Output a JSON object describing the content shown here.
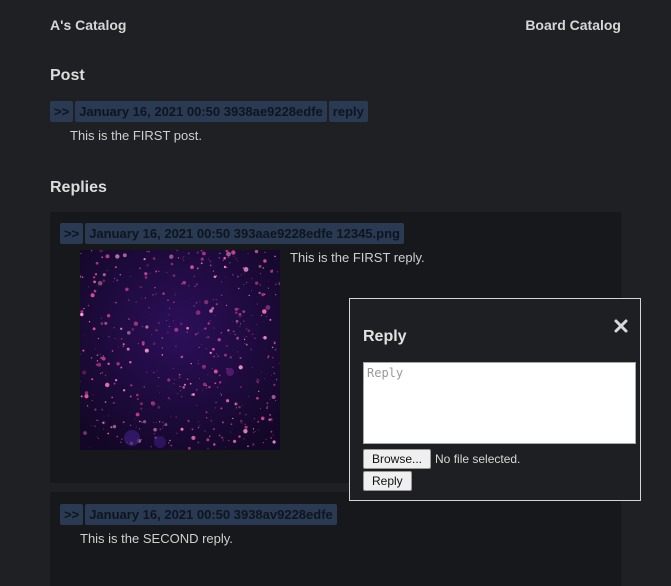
{
  "nav": {
    "left_link": "A's Catalog",
    "right_link": "Board Catalog"
  },
  "post_section": {
    "heading": "Post",
    "tags": {
      "arrow": ">>",
      "meta": "January 16, 2021 00:50 3938ae9228edfe",
      "reply": "reply"
    },
    "text": "This is the FIRST post."
  },
  "replies_section": {
    "heading": "Replies",
    "replies": [
      {
        "arrow": ">>",
        "meta": "January 16, 2021 00:50 393aae9228edfe 12345.png",
        "text": "This is the FIRST reply."
      },
      {
        "arrow": ">>",
        "meta": "January 16, 2021 00:50 3938av9228edfe",
        "text": "This is the SECOND reply."
      }
    ]
  },
  "dialog": {
    "title": "Reply",
    "close_icon": "close-icon",
    "textarea_placeholder": "Reply",
    "browse_label": "Browse...",
    "file_status": "No file selected.",
    "submit_label": "Reply"
  },
  "colors": {
    "background": "#1f2023",
    "reply_background": "#17181b",
    "tag_background": "#293a52",
    "tag_text": "#0f1520"
  }
}
